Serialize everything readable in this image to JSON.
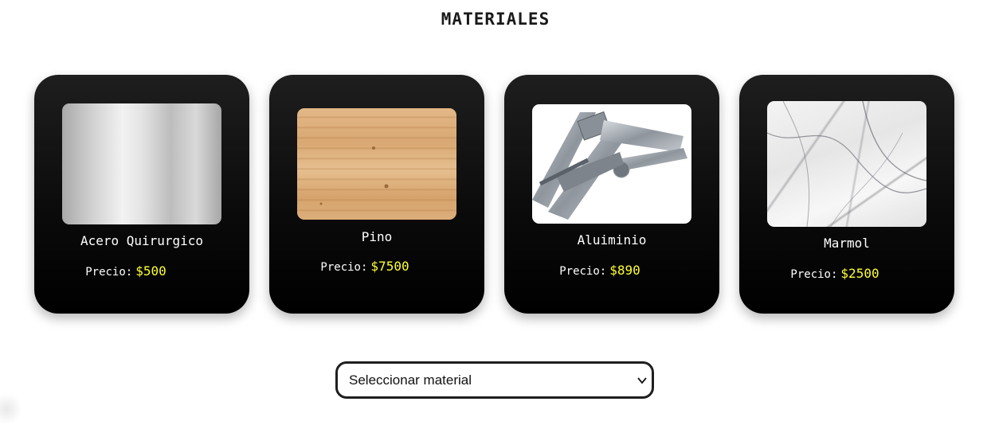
{
  "page": {
    "title": "MATERIALES"
  },
  "materials": [
    {
      "name": "Acero Quirurgico",
      "price_label": "Precio:",
      "price": "$500",
      "image": "steel-sheet-image"
    },
    {
      "name": "Pino",
      "price_label": "Precio:",
      "price": "$7500",
      "image": "pine-wood-image"
    },
    {
      "name": "Aluiminio",
      "price_label": "Precio:",
      "price": "$890",
      "image": "aluminum-profiles-image"
    },
    {
      "name": "Marmol",
      "price_label": "Precio:",
      "price": "$2500",
      "image": "marble-slab-image"
    }
  ],
  "selector": {
    "selected": "Seleccionar material",
    "icon": "chevron-down-icon"
  },
  "colors": {
    "card_background": "#000000",
    "price_accent": "#ffff2e",
    "text": "#ffffff"
  }
}
